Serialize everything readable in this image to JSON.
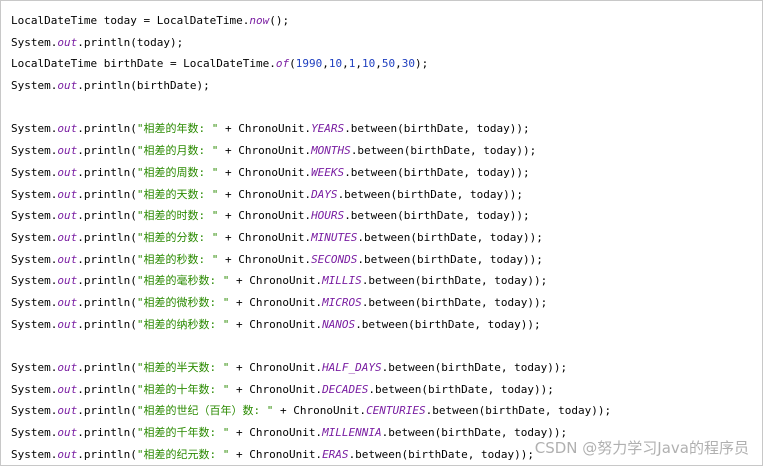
{
  "code": [
    [
      {
        "t": "LocalDateTime today = LocalDateTime."
      },
      {
        "t": "now",
        "c": "fld"
      },
      {
        "t": "();"
      }
    ],
    [
      {
        "t": "System."
      },
      {
        "t": "out",
        "c": "fld"
      },
      {
        "t": ".println(today);"
      }
    ],
    [
      {
        "t": "LocalDateTime birthDate = LocalDateTime."
      },
      {
        "t": "of",
        "c": "fld"
      },
      {
        "t": "("
      },
      {
        "t": "1990",
        "c": "num"
      },
      {
        "t": ","
      },
      {
        "t": "10",
        "c": "num"
      },
      {
        "t": ","
      },
      {
        "t": "1",
        "c": "num"
      },
      {
        "t": ","
      },
      {
        "t": "10",
        "c": "num"
      },
      {
        "t": ","
      },
      {
        "t": "50",
        "c": "num"
      },
      {
        "t": ","
      },
      {
        "t": "30",
        "c": "num"
      },
      {
        "t": ");"
      }
    ],
    [
      {
        "t": "System."
      },
      {
        "t": "out",
        "c": "fld"
      },
      {
        "t": ".println(birthDate);"
      }
    ],
    [],
    [
      {
        "t": "System."
      },
      {
        "t": "out",
        "c": "fld"
      },
      {
        "t": ".println("
      },
      {
        "t": "\"相差的年数: \"",
        "c": "str"
      },
      {
        "t": " + ChronoUnit."
      },
      {
        "t": "YEARS",
        "c": "fld"
      },
      {
        "t": ".between(birthDate, today));"
      }
    ],
    [
      {
        "t": "System."
      },
      {
        "t": "out",
        "c": "fld"
      },
      {
        "t": ".println("
      },
      {
        "t": "\"相差的月数: \"",
        "c": "str"
      },
      {
        "t": " + ChronoUnit."
      },
      {
        "t": "MONTHS",
        "c": "fld"
      },
      {
        "t": ".between(birthDate, today));"
      }
    ],
    [
      {
        "t": "System."
      },
      {
        "t": "out",
        "c": "fld"
      },
      {
        "t": ".println("
      },
      {
        "t": "\"相差的周数: \"",
        "c": "str"
      },
      {
        "t": " + ChronoUnit."
      },
      {
        "t": "WEEKS",
        "c": "fld"
      },
      {
        "t": ".between(birthDate, today));"
      }
    ],
    [
      {
        "t": "System."
      },
      {
        "t": "out",
        "c": "fld"
      },
      {
        "t": ".println("
      },
      {
        "t": "\"相差的天数: \"",
        "c": "str"
      },
      {
        "t": " + ChronoUnit."
      },
      {
        "t": "DAYS",
        "c": "fld"
      },
      {
        "t": ".between(birthDate, today));"
      }
    ],
    [
      {
        "t": "System."
      },
      {
        "t": "out",
        "c": "fld"
      },
      {
        "t": ".println("
      },
      {
        "t": "\"相差的时数: \"",
        "c": "str"
      },
      {
        "t": " + ChronoUnit."
      },
      {
        "t": "HOURS",
        "c": "fld"
      },
      {
        "t": ".between(birthDate, today));"
      }
    ],
    [
      {
        "t": "System."
      },
      {
        "t": "out",
        "c": "fld"
      },
      {
        "t": ".println("
      },
      {
        "t": "\"相差的分数: \"",
        "c": "str"
      },
      {
        "t": " + ChronoUnit."
      },
      {
        "t": "MINUTES",
        "c": "fld"
      },
      {
        "t": ".between(birthDate, today));"
      }
    ],
    [
      {
        "t": "System."
      },
      {
        "t": "out",
        "c": "fld"
      },
      {
        "t": ".println("
      },
      {
        "t": "\"相差的秒数: \"",
        "c": "str"
      },
      {
        "t": " + ChronoUnit."
      },
      {
        "t": "SECONDS",
        "c": "fld"
      },
      {
        "t": ".between(birthDate, today));"
      }
    ],
    [
      {
        "t": "System."
      },
      {
        "t": "out",
        "c": "fld"
      },
      {
        "t": ".println("
      },
      {
        "t": "\"相差的毫秒数: \"",
        "c": "str"
      },
      {
        "t": " + ChronoUnit."
      },
      {
        "t": "MILLIS",
        "c": "fld"
      },
      {
        "t": ".between(birthDate, today));"
      }
    ],
    [
      {
        "t": "System."
      },
      {
        "t": "out",
        "c": "fld"
      },
      {
        "t": ".println("
      },
      {
        "t": "\"相差的微秒数: \"",
        "c": "str"
      },
      {
        "t": " + ChronoUnit."
      },
      {
        "t": "MICROS",
        "c": "fld"
      },
      {
        "t": ".between(birthDate, today));"
      }
    ],
    [
      {
        "t": "System."
      },
      {
        "t": "out",
        "c": "fld"
      },
      {
        "t": ".println("
      },
      {
        "t": "\"相差的纳秒数: \"",
        "c": "str"
      },
      {
        "t": " + ChronoUnit."
      },
      {
        "t": "NANOS",
        "c": "fld"
      },
      {
        "t": ".between(birthDate, today));"
      }
    ],
    [],
    [
      {
        "t": "System."
      },
      {
        "t": "out",
        "c": "fld"
      },
      {
        "t": ".println("
      },
      {
        "t": "\"相差的半天数: \"",
        "c": "str"
      },
      {
        "t": " + ChronoUnit."
      },
      {
        "t": "HALF_DAYS",
        "c": "fld"
      },
      {
        "t": ".between(birthDate, today));"
      }
    ],
    [
      {
        "t": "System."
      },
      {
        "t": "out",
        "c": "fld"
      },
      {
        "t": ".println("
      },
      {
        "t": "\"相差的十年数: \"",
        "c": "str"
      },
      {
        "t": " + ChronoUnit."
      },
      {
        "t": "DECADES",
        "c": "fld"
      },
      {
        "t": ".between(birthDate, today));"
      }
    ],
    [
      {
        "t": "System."
      },
      {
        "t": "out",
        "c": "fld"
      },
      {
        "t": ".println("
      },
      {
        "t": "\"相差的世纪（百年）数: \"",
        "c": "str"
      },
      {
        "t": " + ChronoUnit."
      },
      {
        "t": "CENTURIES",
        "c": "fld"
      },
      {
        "t": ".between(birthDate, today));"
      }
    ],
    [
      {
        "t": "System."
      },
      {
        "t": "out",
        "c": "fld"
      },
      {
        "t": ".println("
      },
      {
        "t": "\"相差的千年数: \"",
        "c": "str"
      },
      {
        "t": " + ChronoUnit."
      },
      {
        "t": "MILLENNIA",
        "c": "fld"
      },
      {
        "t": ".between(birthDate, today));"
      }
    ],
    [
      {
        "t": "System."
      },
      {
        "t": "out",
        "c": "fld"
      },
      {
        "t": ".println("
      },
      {
        "t": "\"相差的纪元数: \"",
        "c": "str"
      },
      {
        "t": " + ChronoUnit."
      },
      {
        "t": "ERAS",
        "c": "fld"
      },
      {
        "t": ".between(birthDate, today));"
      }
    ]
  ],
  "watermark": "CSDN @努力学习Java的程序员"
}
